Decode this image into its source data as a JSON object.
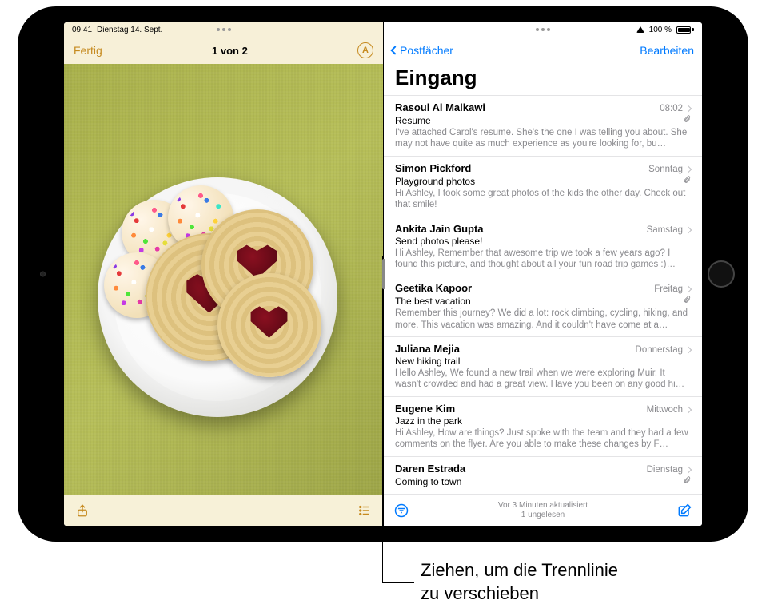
{
  "statusbar": {
    "time": "09:41",
    "date": "Dienstag 14. Sept.",
    "battery_pct": "100 %"
  },
  "photos": {
    "done": "Fertig",
    "counter": "1 von 2",
    "badge_letter": "A"
  },
  "mail": {
    "back_label": "Postfächer",
    "edit_label": "Bearbeiten",
    "title": "Eingang",
    "status_line1": "Vor 3 Minuten aktualisiert",
    "status_line2": "1 ungelesen",
    "rows": [
      {
        "sender": "Rasoul Al Malkawi",
        "time": "08:02",
        "subject": "Resume",
        "preview": "I've attached Carol's resume. She's the one I was telling you about. She may not have quite as much experience as you're looking for, bu…",
        "attachment": true
      },
      {
        "sender": "Simon Pickford",
        "time": "Sonntag",
        "subject": "Playground photos",
        "preview": "Hi Ashley, I took some great photos of the kids the other day. Check out that smile!",
        "attachment": true
      },
      {
        "sender": "Ankita Jain Gupta",
        "time": "Samstag",
        "subject": "Send photos please!",
        "preview": "Hi Ashley, Remember that awesome trip we took a few years ago? I found this picture, and thought about all your fun road trip games :)…",
        "attachment": false
      },
      {
        "sender": "Geetika Kapoor",
        "time": "Freitag",
        "subject": "The best vacation",
        "preview": "Remember this journey? We did a lot: rock climbing, cycling, hiking, and more. This vacation was amazing. And it couldn't have come at a…",
        "attachment": true
      },
      {
        "sender": "Juliana Mejia",
        "time": "Donnerstag",
        "subject": "New hiking trail",
        "preview": "Hello Ashley, We found a new trail when we were exploring Muir. It wasn't crowded and had a great view. Have you been on any good hi…",
        "attachment": false
      },
      {
        "sender": "Eugene Kim",
        "time": "Mittwoch",
        "subject": "Jazz in the park",
        "preview": "Hi Ashley, How are things? Just spoke with the team and they had a few comments on the flyer. Are you able to make these changes by F…",
        "attachment": false
      },
      {
        "sender": "Daren Estrada",
        "time": "Dienstag",
        "subject": "Coming to town",
        "preview": "",
        "attachment": true
      }
    ]
  },
  "callout": {
    "line1": "Ziehen, um die Trennlinie",
    "line2": "zu verschieben"
  }
}
